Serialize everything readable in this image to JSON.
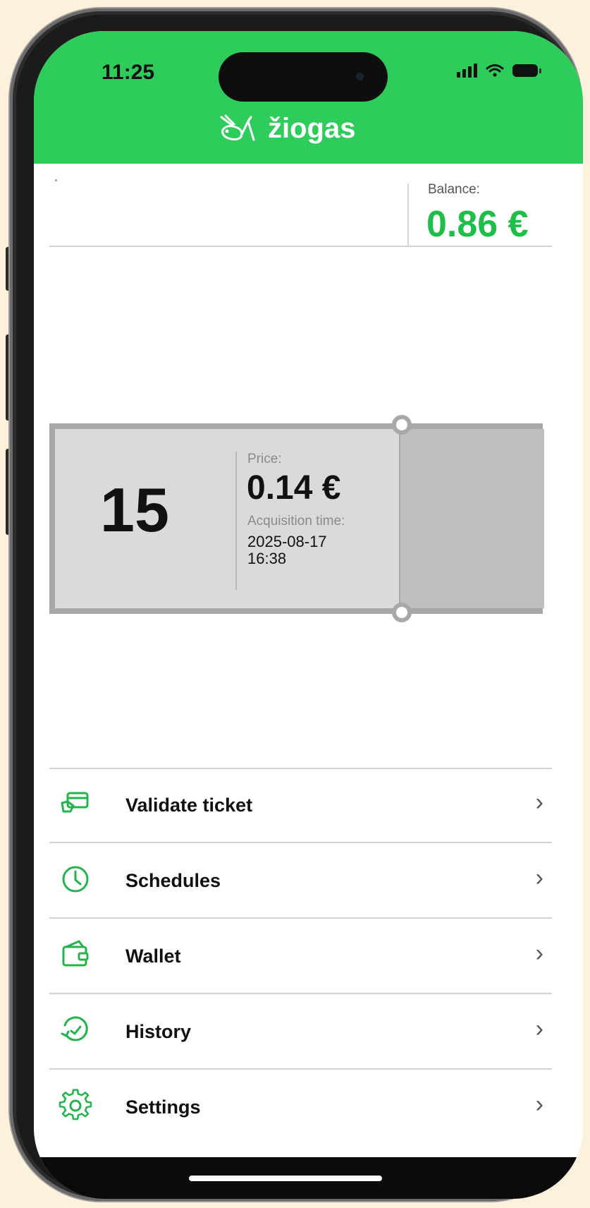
{
  "status_bar": {
    "time": "11:25"
  },
  "header": {
    "brand": "žiogas",
    "colors": {
      "accent": "#2ecc5a",
      "brand_text": "#ffffff"
    }
  },
  "balance": {
    "label": "Balance:",
    "value": "0.86 €",
    "color": "#1dbf49"
  },
  "ticket": {
    "number": "15",
    "price_label": "Price:",
    "price": "0.14 €",
    "acquisition_label": "Acquisition time:",
    "acquisition_time": "2025-08-17 16:38"
  },
  "menu": [
    {
      "label": "Validate ticket",
      "icon": "ticket-icon"
    },
    {
      "label": "Schedules",
      "icon": "clock-icon"
    },
    {
      "label": "Wallet",
      "icon": "wallet-icon"
    },
    {
      "label": "History",
      "icon": "history-icon"
    },
    {
      "label": "Settings",
      "icon": "gear-icon"
    }
  ]
}
